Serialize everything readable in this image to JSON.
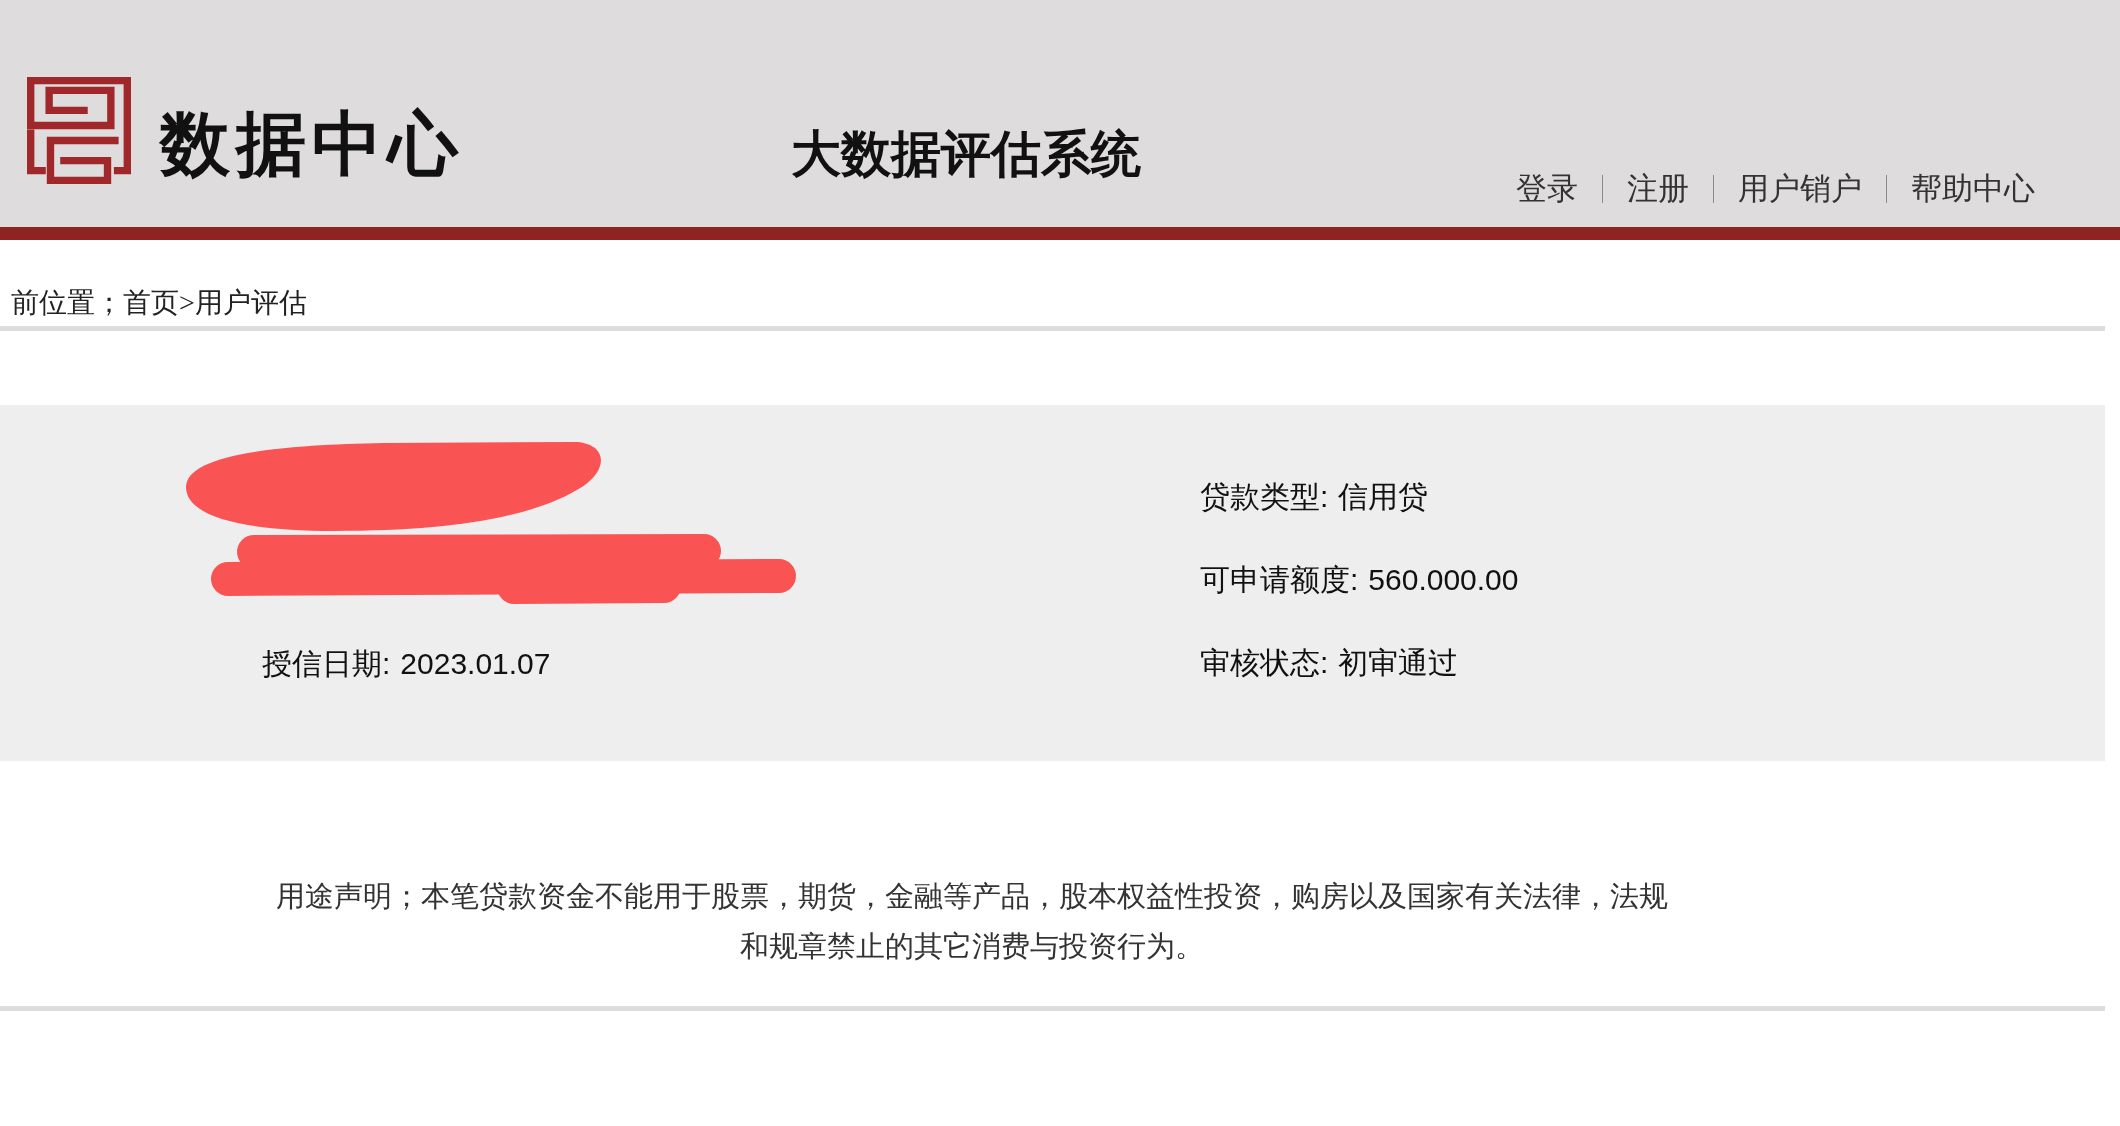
{
  "header": {
    "logo_text": "数据中心",
    "title": "大数据评估系统",
    "nav": [
      "登录",
      "注册",
      "用户销户",
      "帮助中心"
    ]
  },
  "breadcrumb": "前位置；首页>用户评估",
  "credit_panel": {
    "left_fields": [
      {
        "label": "授信日期:",
        "value": "2023.01.07"
      }
    ],
    "right_fields": [
      {
        "label": "贷款类型:",
        "value": "信用贷"
      },
      {
        "label": "可申请额度:",
        "value": "560.000.00"
      },
      {
        "label": "审核状态:",
        "value": "初审通过"
      }
    ]
  },
  "statement": "用途声明；本笔贷款资金不能用于股票，期货，金融等产品，股本权益性投资，购房以及国家有关法律，法规和规章禁止的其它消费与投资行为。"
}
